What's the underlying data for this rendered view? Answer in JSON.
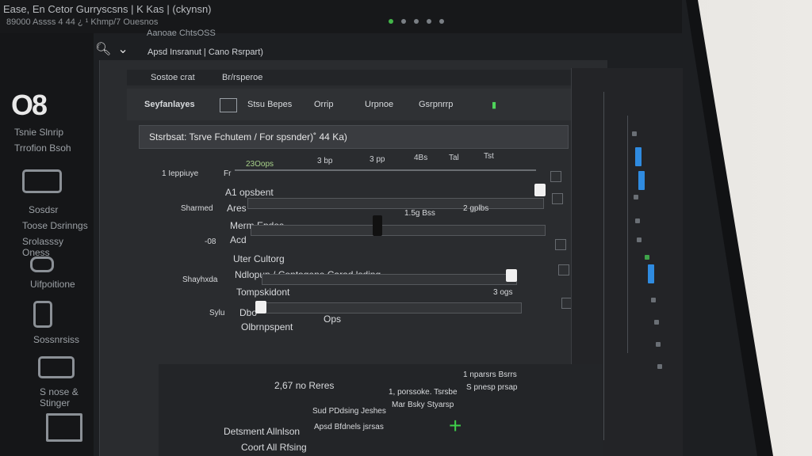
{
  "topbar": {
    "line1": "Ease, En Cetor Gurryscsns | K Kas | (ckynsn)",
    "line2": "89000 Assss 4 44 ¿ ¹ Khmp/7 Ouesnos",
    "line3": "Aanoae ChtsOSS",
    "title": "Apsd Insranut | Cano Rsrpart)"
  },
  "sidebar": {
    "logo": "O8",
    "items": [
      {
        "label": "Tsnie Slnrip"
      },
      {
        "label": "Trrofion Bsoh"
      },
      {
        "label": "Sosdsr"
      },
      {
        "label": "Toose Dsrinngs"
      },
      {
        "label": "Srolasssy Oness"
      },
      {
        "label": "Uifpoitione"
      },
      {
        "label": "Sossnrsiss"
      },
      {
        "label": "S nose & Stinger"
      }
    ]
  },
  "panel": {
    "tab_left": "Sostoe crat",
    "tab_right": "Br/rsperoe",
    "toolbar": [
      {
        "label": "Seyfanlayes"
      },
      {
        "label": "Stsu Bepes"
      },
      {
        "label": "Orrip"
      },
      {
        "label": "Urpnoe"
      },
      {
        "label": "Gsrpnrrp"
      }
    ],
    "section_title": "Stsrbsat:  Tsrve  Fchutem / For spsnder)˚ 44 Ka)",
    "scale_labels": [
      "23Oops",
      "3 bp",
      "3 pp",
      "4Bs",
      "Tal",
      "Tst"
    ],
    "rows": {
      "r1": "1 Ieppiuye",
      "r1b": "Fr",
      "r2": "A1 opsbent",
      "r3l": "Sharmed",
      "r3": "Ares",
      "v3a": "1.5g Bss",
      "v3b": "2 gplbs",
      "r4": "Merm Epdos",
      "r5l": "-08",
      "r5": "Acd",
      "r6": "Uter Cultorg",
      "r7l": "Shayhxda",
      "r7": "Ndlopun / Contogene Carad lsding",
      "r8": "Tompskidont",
      "v8": "3 ogs",
      "r9l": "Sylu",
      "r9": "Dbo",
      "r10": "Olbrnpspent",
      "r10b": "Ops"
    }
  },
  "bottom": {
    "label": "2,67 no Reres",
    "left1": "Detsment Allnlson",
    "left2": "Coort All Rfsing",
    "mid1": "Sud PDdsing Jeshes",
    "mid2": "Apsd Bfdnels jsrsas",
    "right1": "1, porssoke. Tsrsbe",
    "right2": "Mar Bsky Styarsp",
    "right3": "1 nparsrs   Bsrrs",
    "right4": "S pnesp  prsap"
  }
}
